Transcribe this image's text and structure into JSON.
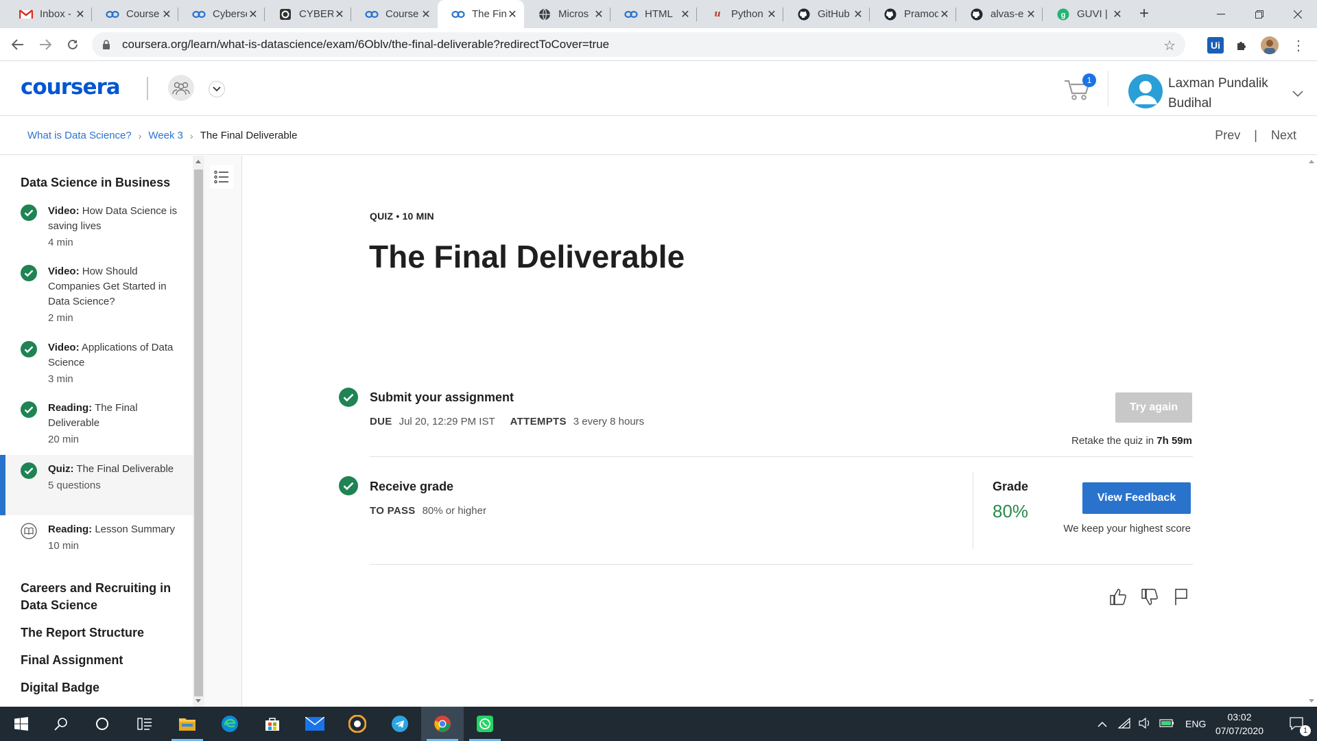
{
  "browser": {
    "tabs": [
      {
        "title": "Inbox -",
        "icon": "gmail-icon"
      },
      {
        "title": "Course",
        "icon": "coursera-icon"
      },
      {
        "title": "Cyberse",
        "icon": "coursera-icon"
      },
      {
        "title": "CYBERS",
        "icon": "cyber-site-icon"
      },
      {
        "title": "Course",
        "icon": "coursera-icon"
      },
      {
        "title": "The Fin",
        "icon": "coursera-icon",
        "active": true
      },
      {
        "title": "Micros",
        "icon": "globe-icon"
      },
      {
        "title": "HTML",
        "icon": "coursera-icon"
      },
      {
        "title": "Python",
        "icon": "udemy-icon"
      },
      {
        "title": "GitHub",
        "icon": "github-icon"
      },
      {
        "title": "Pramod",
        "icon": "github-icon"
      },
      {
        "title": "alvas-e",
        "icon": "github-icon"
      },
      {
        "title": "GUVI |",
        "icon": "guvi-icon"
      }
    ],
    "url": "coursera.org/learn/what-is-datascience/exam/6Oblv/the-final-deliverable?redirectToCover=true",
    "ext_ui_label": "Ui"
  },
  "header": {
    "logo": "coursera",
    "cart_count": "1",
    "user_name_line1": "Laxman Pundalik",
    "user_name_line2": "Budihal"
  },
  "breadcrumb": {
    "items": [
      "What is Data Science?",
      "Week 3",
      "The Final Deliverable"
    ],
    "prev": "Prev",
    "next": "Next"
  },
  "sidebar": {
    "section_title": "Data Science in Business",
    "items": [
      {
        "type": "Video:",
        "title": "How Data Science is saving lives",
        "duration": "4 min",
        "done": true
      },
      {
        "type": "Video:",
        "title": "How Should Companies Get Started in Data Science?",
        "duration": "2 min",
        "done": true
      },
      {
        "type": "Video:",
        "title": "Applications of Data Science",
        "duration": "3 min",
        "done": true
      },
      {
        "type": "Reading:",
        "title": "The Final Deliverable",
        "duration": "20 min",
        "done": true
      },
      {
        "type": "Quiz:",
        "title": "The Final Deliverable",
        "duration": "5 questions",
        "done": true,
        "active": true
      },
      {
        "type": "Reading:",
        "title": "Lesson Summary",
        "duration": "10 min",
        "done": false
      }
    ],
    "other_sections": [
      "Careers and Recruiting in Data Science",
      "The Report Structure",
      "Final Assignment",
      "Digital Badge"
    ]
  },
  "main": {
    "kicker": "QUIZ • 10 MIN",
    "title": "The Final Deliverable",
    "submit": {
      "title": "Submit your assignment",
      "due_label": "DUE",
      "due_value": "Jul 20, 12:29 PM IST",
      "attempts_label": "ATTEMPTS",
      "attempts_value": "3 every 8 hours",
      "try_again": "Try again",
      "retake_prefix": "Retake the quiz in",
      "retake_time": "7h 59m"
    },
    "grade": {
      "title": "Receive grade",
      "to_pass_label": "TO PASS",
      "to_pass_value": "80% or higher",
      "grade_label": "Grade",
      "grade_value": "80%",
      "view_feedback": "View Feedback",
      "keep_note": "We keep your highest score"
    }
  },
  "taskbar": {
    "lang": "ENG",
    "time": "03:02",
    "date": "07/07/2020",
    "notifications": "1"
  },
  "colors": {
    "brand": "#0056d2",
    "link": "#2a73cc",
    "success": "#1f8354",
    "grade_green": "#2a8a4a",
    "button_primary": "#2a73cc",
    "button_disabled": "#c8c8c8"
  }
}
